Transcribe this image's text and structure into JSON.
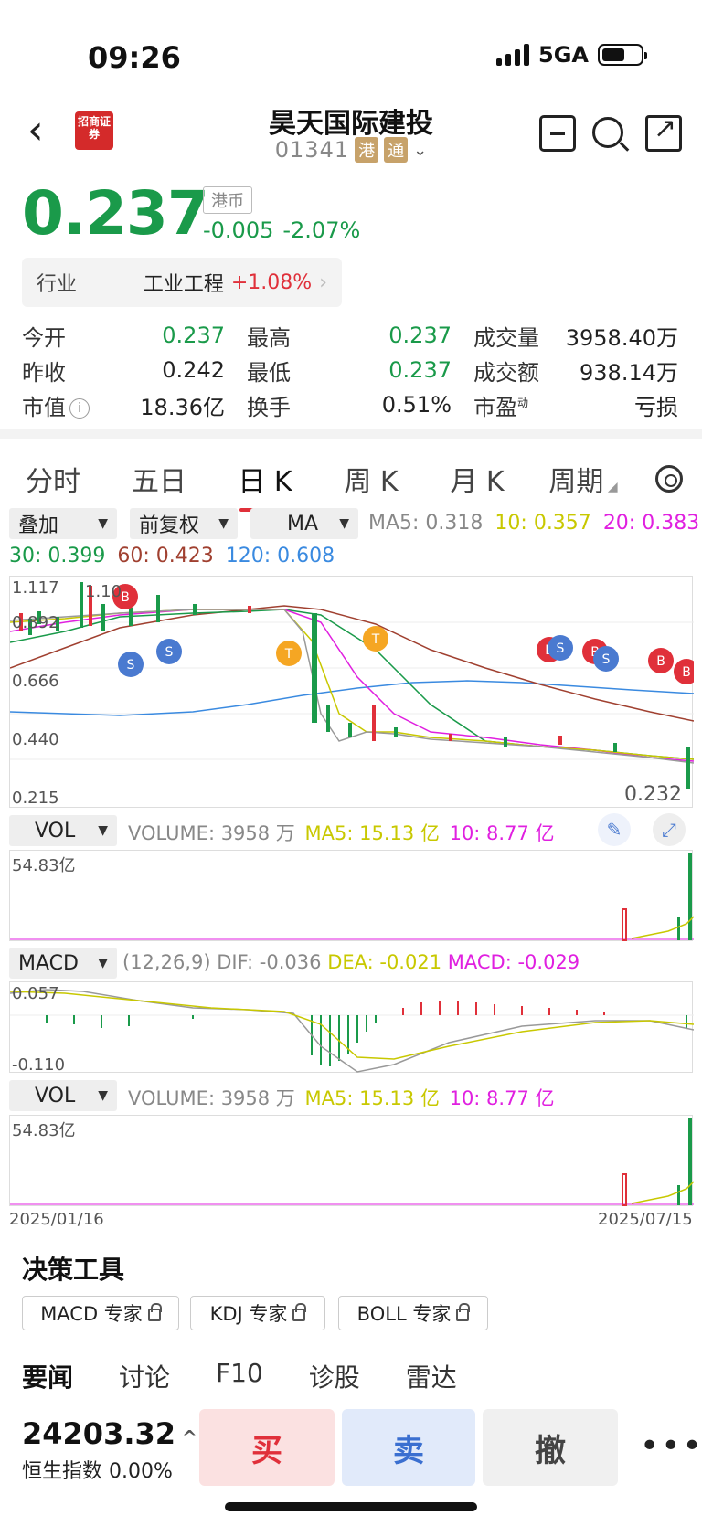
{
  "status_bar": {
    "time": "09:26",
    "network": "5GA"
  },
  "header": {
    "logo_text": "招商证券",
    "stock_name": "昊天国际建投",
    "stock_code": "01341",
    "tag1": "港",
    "tag2": "通"
  },
  "quote": {
    "price": "0.237",
    "currency": "港币",
    "change": "-0.005",
    "change_pct": "-2.07%",
    "industry_label": "行业",
    "industry_name": "工业工程",
    "industry_change": "+1.08%",
    "rows": [
      [
        {
          "label": "今开",
          "value": "0.237",
          "color": "#1a9a4a"
        },
        {
          "label": "最高",
          "value": "0.237",
          "color": "#1a9a4a"
        },
        {
          "label": "成交量",
          "value": "3958.40万",
          "color": "#222222"
        }
      ],
      [
        {
          "label": "昨收",
          "value": "0.242",
          "color": "#222222"
        },
        {
          "label": "最低",
          "value": "0.237",
          "color": "#1a9a4a"
        },
        {
          "label": "成交额",
          "value": "938.14万",
          "color": "#222222"
        }
      ],
      [
        {
          "label": "市值",
          "value": "18.36亿",
          "color": "#222222"
        },
        {
          "label": "换手",
          "value": "0.51%",
          "color": "#222222"
        },
        {
          "label": "市盈",
          "value": "亏损",
          "color": "#222222"
        }
      ]
    ],
    "pe_superscript": "动"
  },
  "tabs": [
    "分时",
    "五日",
    "日 K",
    "周 K",
    "月 K",
    "周期"
  ],
  "active_tab": 2,
  "selectors": {
    "overlay": "叠加",
    "adjust": "前复权",
    "indicator": "MA"
  },
  "ma_legend": {
    "ma5": "MA5: 0.318",
    "ma10": "10: 0.357",
    "ma20": "20: 0.383",
    "ma30": "30: 0.399",
    "ma60": "60: 0.423",
    "ma120": "120: 0.608"
  },
  "kline": {
    "y_labels": [
      "1.117",
      "0.892",
      "0.666",
      "0.440",
      "0.215"
    ],
    "high_label": "1.10",
    "last_label": "0.232"
  },
  "vol1": {
    "selector": "VOL",
    "volume": "VOLUME: 3958 万",
    "ma5": "MA5: 15.13 亿",
    "ma10": "10: 8.77 亿",
    "max_label": "54.83亿"
  },
  "macd": {
    "selector": "MACD",
    "params": "(12,26,9)",
    "dif": "DIF: -0.036",
    "dea": "DEA: -0.021",
    "macd": "MACD: -0.029",
    "top_label": "0.057",
    "bottom_label": "-0.110"
  },
  "vol2": {
    "selector": "VOL",
    "volume": "VOLUME: 3958 万",
    "ma5": "MA5: 15.13 亿",
    "ma10": "10: 8.77 亿",
    "max_label": "54.83亿"
  },
  "dates": {
    "start": "2025/01/16",
    "end": "2025/07/15"
  },
  "tools": {
    "title": "决策工具",
    "buttons": [
      "MACD 专家",
      "KDJ 专家",
      "BOLL 专家"
    ]
  },
  "news_tabs": [
    "要闻",
    "讨论",
    "F10",
    "诊股",
    "雷达"
  ],
  "bottom": {
    "index_value": "24203.32",
    "index_name": "恒生指数",
    "index_change": "0.00%",
    "buy": "买",
    "sell": "卖",
    "cancel": "撤"
  },
  "colors": {
    "up": "#e0303a",
    "down": "#1a9a4a",
    "ma5": "#888888",
    "ma10": "#c8c800",
    "ma20": "#e020e0",
    "ma30": "#1a9a4a",
    "ma60": "#a04030",
    "ma120": "#3a8ae0"
  }
}
